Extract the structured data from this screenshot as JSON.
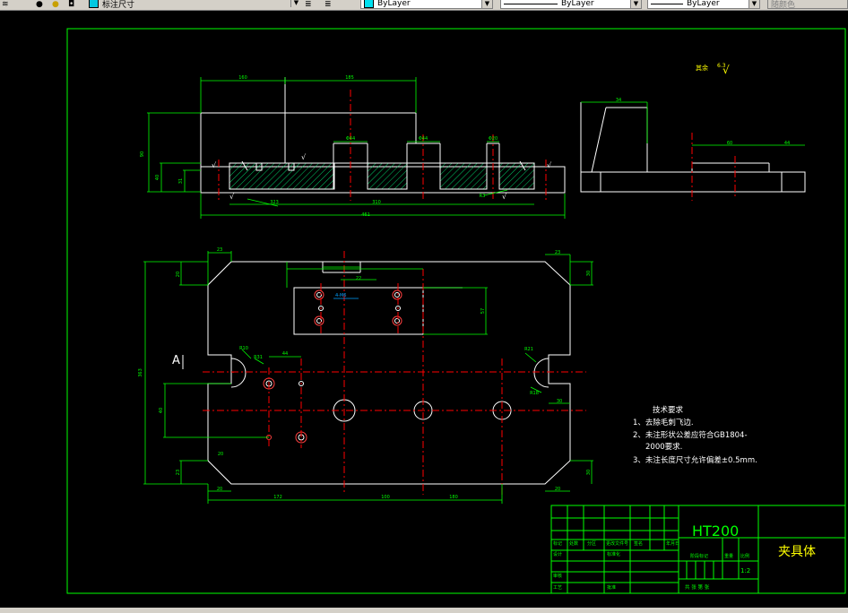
{
  "toolbar": {
    "layer_name": "标注尺寸",
    "color_combo": "ByLayer",
    "linetype_combo": "ByLayer",
    "lineweight_combo": "ByLayer",
    "plotstyle_combo": "随颜色"
  },
  "drawing": {
    "top_view_dims": {
      "d_top_left": "160",
      "d_top_mid": "185",
      "d_height": "90",
      "d_h2": "40",
      "d_h3": "31",
      "d_bore1": "Φ44",
      "d_bore2": "Φ44",
      "d_bore3": "Φ20",
      "d_width1": "323",
      "d_width2": "310",
      "d_total": "461",
      "d_r": "R3"
    },
    "side_view_dims": {
      "d_side1": "34",
      "d_side2": "60",
      "d_side3": "44",
      "roughness_note": "其余",
      "roughness_val": "6.3"
    },
    "plan_view_dims": {
      "d_left_top": "23",
      "d_left_side": "20",
      "d_height_total": "363",
      "d_r10": "R10",
      "d_r31": "R31",
      "d_44": "44",
      "d_40": "40",
      "d_22": "22",
      "d_height2": "57",
      "d_bottom_left": "23",
      "d_bottom_r": "20",
      "d_172": "172",
      "d_100": "100",
      "d_180": "180",
      "d_right_top": "23",
      "d_right_side": "30",
      "d_r21": "R21",
      "d_r18": "R18",
      "d_right_30": "30",
      "d_right_bottom": "30",
      "d_bottom_right_20": "20",
      "section_mark": "A",
      "d_small": "20",
      "d_label_blue": "4-M6"
    },
    "tech_requirements": {
      "title": "技术要求",
      "line1": "1、去除毛刺飞边.",
      "line2": "2、未注形状公差应符合GB1804-",
      "line3": "2000要求.",
      "line4": "3、未注长度尺寸允许偏差±0.5mm."
    },
    "title_block": {
      "material": "HT200",
      "part_name": "夹具体",
      "scale": "1:2",
      "r_mark": "标记",
      "r_count": "处数",
      "r_zone": "分区",
      "r_docno": "更改文件号",
      "r_sign": "签名",
      "r_date": "年月日",
      "r_design": "设计",
      "r_standard": "标准化",
      "r_check": "审核",
      "r_craft": "工艺",
      "r_approve": "批准",
      "r_stage": "阶段标记",
      "r_weight": "重量",
      "r_ratio": "比例",
      "r_sheets": "共  张  第  张"
    }
  },
  "colors": {
    "frame": "#00ff00",
    "geometry": "#ffffff",
    "dimension": "#00ff00",
    "center": "#ff0000",
    "hatch": "#00ff80",
    "text_yellow": "#ffff00",
    "text_white": "#ffffff",
    "blue_label": "#00a0ff"
  }
}
